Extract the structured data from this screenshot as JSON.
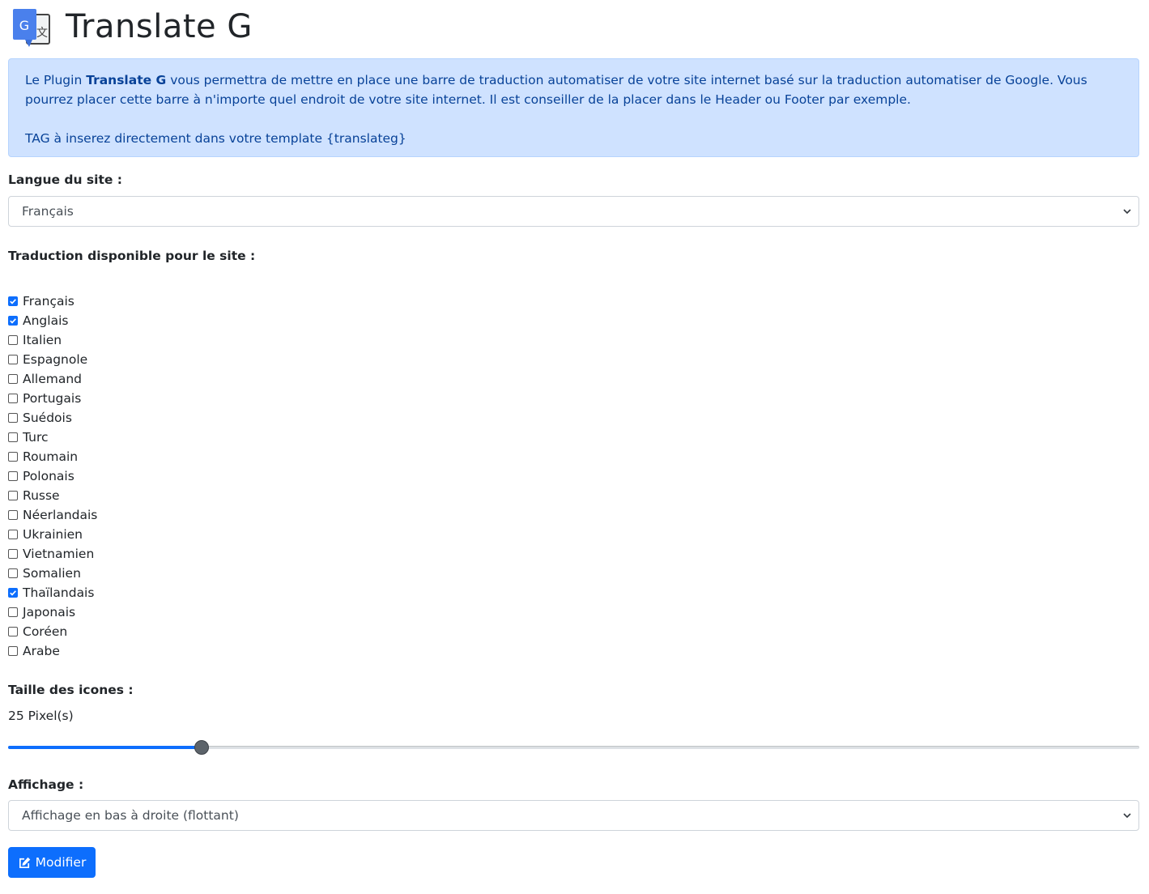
{
  "header": {
    "title": "Translate G",
    "logo_icon": "google-translate-icon"
  },
  "info": {
    "intro_prefix": "Le Plugin ",
    "intro_strong": "Translate G",
    "intro_suffix": " vous permettra de mettre en place une barre de traduction automatiser de votre site internet basé sur la traduction automatiser de Google. Vous pourrez placer cette barre à n'importe quel endroit de votre site internet. Il est conseiller de la placer dans le Header ou Footer par exemple.",
    "tag_text": "TAG à inserez directement dans votre template {translateg}",
    "bg_color": "#cfe2ff",
    "text_color": "#084298"
  },
  "site_language": {
    "label": "Langue du site :",
    "selected": "Français"
  },
  "translations": {
    "label": "Traduction disponible pour le site :",
    "languages": [
      {
        "label": "Français",
        "checked": true
      },
      {
        "label": "Anglais",
        "checked": true
      },
      {
        "label": "Italien",
        "checked": false
      },
      {
        "label": "Espagnole",
        "checked": false
      },
      {
        "label": "Allemand",
        "checked": false
      },
      {
        "label": "Portugais",
        "checked": false
      },
      {
        "label": "Suédois",
        "checked": false
      },
      {
        "label": "Turc",
        "checked": false
      },
      {
        "label": "Roumain",
        "checked": false
      },
      {
        "label": "Polonais",
        "checked": false
      },
      {
        "label": "Russe",
        "checked": false
      },
      {
        "label": "Néerlandais",
        "checked": false
      },
      {
        "label": "Ukrainien",
        "checked": false
      },
      {
        "label": "Vietnamien",
        "checked": false
      },
      {
        "label": "Somalien",
        "checked": false
      },
      {
        "label": "Thaïlandais",
        "checked": true
      },
      {
        "label": "Japonais",
        "checked": false
      },
      {
        "label": "Coréen",
        "checked": false
      },
      {
        "label": "Arabe",
        "checked": false
      }
    ]
  },
  "icon_size": {
    "label": "Taille des icones :",
    "value_text": "25 Pixel(s)",
    "slider_fraction": 0.171
  },
  "display": {
    "label": "Affichage :",
    "selected": "Affichage en bas à droite (flottant)"
  },
  "submit": {
    "label": "Modifier",
    "icon": "edit-icon"
  },
  "colors": {
    "primary": "#0d6efd",
    "thumb": "#5c636a"
  }
}
